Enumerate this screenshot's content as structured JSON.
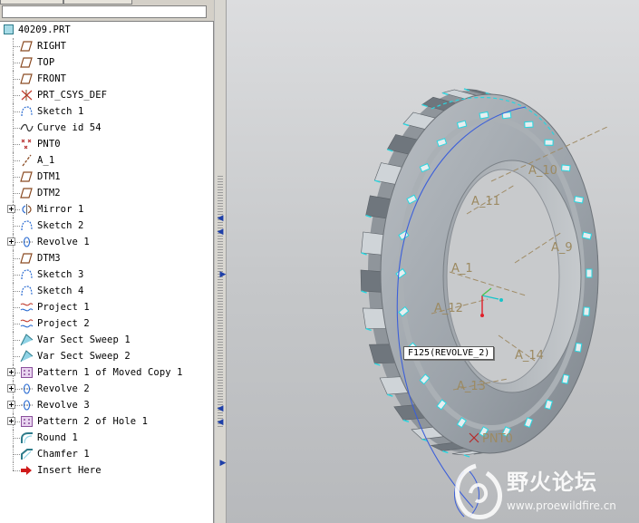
{
  "model_tree": {
    "root": {
      "label": "40209.PRT",
      "icon": "part-icon"
    },
    "items": [
      {
        "label": "RIGHT",
        "icon": "datum-plane-icon",
        "expandable": false
      },
      {
        "label": "TOP",
        "icon": "datum-plane-icon",
        "expandable": false
      },
      {
        "label": "FRONT",
        "icon": "datum-plane-icon",
        "expandable": false
      },
      {
        "label": "PRT_CSYS_DEF",
        "icon": "csys-icon",
        "expandable": false
      },
      {
        "label": "Sketch 1",
        "icon": "sketch-icon",
        "expandable": false
      },
      {
        "label": "Curve id 54",
        "icon": "curve-icon",
        "expandable": false
      },
      {
        "label": "PNT0",
        "icon": "datum-point-icon",
        "expandable": false
      },
      {
        "label": "A_1",
        "icon": "datum-axis-icon",
        "expandable": false
      },
      {
        "label": "DTM1",
        "icon": "datum-plane-icon",
        "expandable": false
      },
      {
        "label": "DTM2",
        "icon": "datum-plane-icon",
        "expandable": false
      },
      {
        "label": "Mirror 1",
        "icon": "mirror-icon",
        "expandable": true
      },
      {
        "label": "Sketch 2",
        "icon": "sketch-icon",
        "expandable": false
      },
      {
        "label": "Revolve 1",
        "icon": "revolve-icon",
        "expandable": true
      },
      {
        "label": "DTM3",
        "icon": "datum-plane-icon",
        "expandable": false
      },
      {
        "label": "Sketch 3",
        "icon": "sketch-icon",
        "expandable": false
      },
      {
        "label": "Sketch 4",
        "icon": "sketch-icon",
        "expandable": false
      },
      {
        "label": "Project 1",
        "icon": "project-icon",
        "expandable": false
      },
      {
        "label": "Project 2",
        "icon": "project-icon",
        "expandable": false
      },
      {
        "label": "Var Sect Sweep 1",
        "icon": "sweep-icon",
        "expandable": false
      },
      {
        "label": "Var Sect Sweep 2",
        "icon": "sweep-icon",
        "expandable": false
      },
      {
        "label": "Pattern 1 of Moved Copy 1",
        "icon": "pattern-icon",
        "expandable": true
      },
      {
        "label": "Revolve 2",
        "icon": "revolve-icon",
        "expandable": true
      },
      {
        "label": "Revolve 3",
        "icon": "revolve-icon",
        "expandable": true
      },
      {
        "label": "Pattern 2 of Hole 1",
        "icon": "pattern-icon",
        "expandable": true
      },
      {
        "label": "Round 1",
        "icon": "round-icon",
        "expandable": false
      },
      {
        "label": "Chamfer 1",
        "icon": "chamfer-icon",
        "expandable": false
      },
      {
        "label": "Insert Here",
        "icon": "insert-here-arrow-icon",
        "expandable": false
      }
    ]
  },
  "viewport": {
    "axis_labels": {
      "a10": "A_10",
      "a11": "A_11",
      "a9": "A_9",
      "a1": "A_1",
      "a12": "A_12",
      "a14": "A_14",
      "a13": "A_13"
    },
    "point_label": "PNT0",
    "tooltip": "F125(REVOLVE_2)"
  },
  "watermark": {
    "text_cn": "野火论坛",
    "url": "www.proewildfire.cn"
  },
  "colors": {
    "datum_edge": "#29d6e0",
    "axis_label": "#9c8a62",
    "gear_face": "#9ea4aa",
    "curve_blue": "#3c5fd9"
  }
}
